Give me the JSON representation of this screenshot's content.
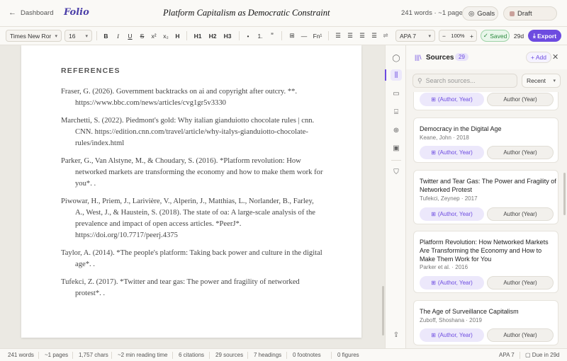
{
  "header": {
    "back_label": "Dashboard",
    "logo": "Folio",
    "doc_title": "Platform Capitalism as Democratic Constraint",
    "word_count": "241 words · ~1 page",
    "goals_label": "Goals",
    "draft_label": "Draft"
  },
  "toolbar": {
    "font": "Times New Ror",
    "size": "16",
    "bold": "B",
    "italic": "I",
    "underline": "U",
    "strike": "S",
    "superscript": "x²",
    "subscript": "x₂",
    "heading": "H",
    "h1": "H1",
    "h2": "H2",
    "h3": "H3",
    "bullet": "•",
    "numbered": "1.",
    "quote": "”",
    "footnote": "Fn¹",
    "style": "APA 7",
    "zoom_minus": "−",
    "zoom": "100%",
    "zoom_plus": "+",
    "saved": "Saved",
    "due": "29d",
    "export": "Export"
  },
  "document": {
    "heading": "REFERENCES",
    "references": [
      "Fraser, G. (2026). Government backtracks on ai and copyright after outcry. **. https://www.bbc.com/news/articles/cvg1gr5v3330",
      "Marchetti, S. (2022). Piedmont's gold: Why italian gianduiotto chocolate rules | cnn. CNN. https://edition.cnn.com/travel/article/why-italys-gianduiotto-chocolate-rules/index.html",
      "Parker, G., Van Alstyne, M., & Choudary, S. (2016). *Platform revolution: How networked markets are transforming the economy and how to make them work for you*. .",
      "Piwowar, H., Priem, J., Larivière, V., Alperin, J., Matthias, L., Norlander, B., Farley, A., West, J., & Haustein, S. (2018). The state of oa: A large-scale analysis of the prevalence and impact of open access articles. *PeerJ*. https://doi.org/10.7717/peerj.4375",
      "Taylor, A. (2014). *The people's platform: Taking back power and culture in the digital age*. .",
      "Tufekci, Z. (2017). *Twitter and tear gas: The power and fragility of networked protest*. ."
    ]
  },
  "panel": {
    "title": "Sources",
    "count": "29",
    "add_label": "+ Add",
    "search_placeholder": "Search sources...",
    "sort": "Recent",
    "cite_label": "(Author, Year)",
    "author_label": "Author (Year)",
    "sources": [
      {
        "title": "Democracy in the Digital Age",
        "meta": "Keane, John · 2018"
      },
      {
        "title": "Twitter and Tear Gas: The Power and Fragility of Networked Protest",
        "meta": "Tufekci, Zeynep · 2017"
      },
      {
        "title": "Platform Revolution: How Networked Markets Are Transforming the Economy and How to Make Them Work for You",
        "meta": "Parker et al. · 2016"
      },
      {
        "title": "The Age of Surveillance Capitalism",
        "meta": "Zuboff, Shoshana · 2019"
      }
    ]
  },
  "status": {
    "words": "241 words",
    "pages": "~1 pages",
    "chars": "1,757 chars",
    "reading": "~2 min reading time",
    "citations": "6 citations",
    "sources": "29 sources",
    "headings": "7 headings",
    "footnotes": "0 footnotes",
    "figures": "0 figures",
    "style": "APA 7",
    "due": "Due in 29d"
  }
}
